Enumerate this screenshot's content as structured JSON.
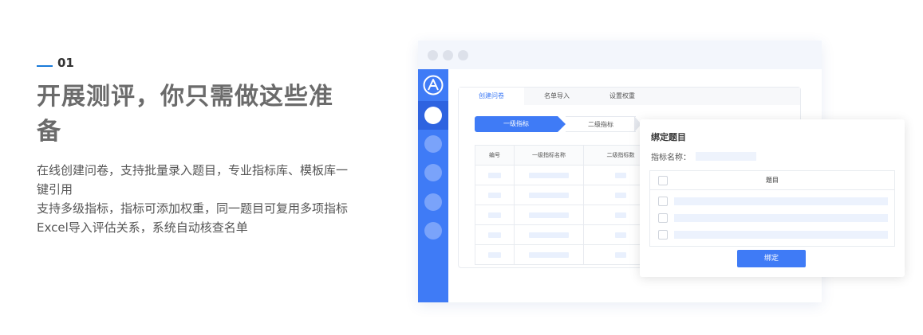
{
  "intro": {
    "number": "01",
    "title": "开展测评，你只需做这些准备",
    "desc_lines": [
      "在线创建问卷，支持批量录入题目，专业指标库、模板库一键引用",
      "支持多级指标，指标可添加权重，同一题目可复用多项指标 Excel导入评估关系，系统自动核查名单"
    ]
  },
  "app": {
    "tabs": [
      "创建问卷",
      "名单导入",
      "设置权重"
    ],
    "steps": [
      "一级指标",
      "二级指标"
    ],
    "table_headers": [
      "编号",
      "一级指标名称",
      "二级指标数"
    ]
  },
  "dialog": {
    "title": "绑定题目",
    "field_label": "指标名称：",
    "column_header": "题目",
    "button": "绑定"
  },
  "colors": {
    "accent": "#3f7bf6",
    "title_gray": "#6b6b6b",
    "number_line": "#1a7ad9"
  }
}
